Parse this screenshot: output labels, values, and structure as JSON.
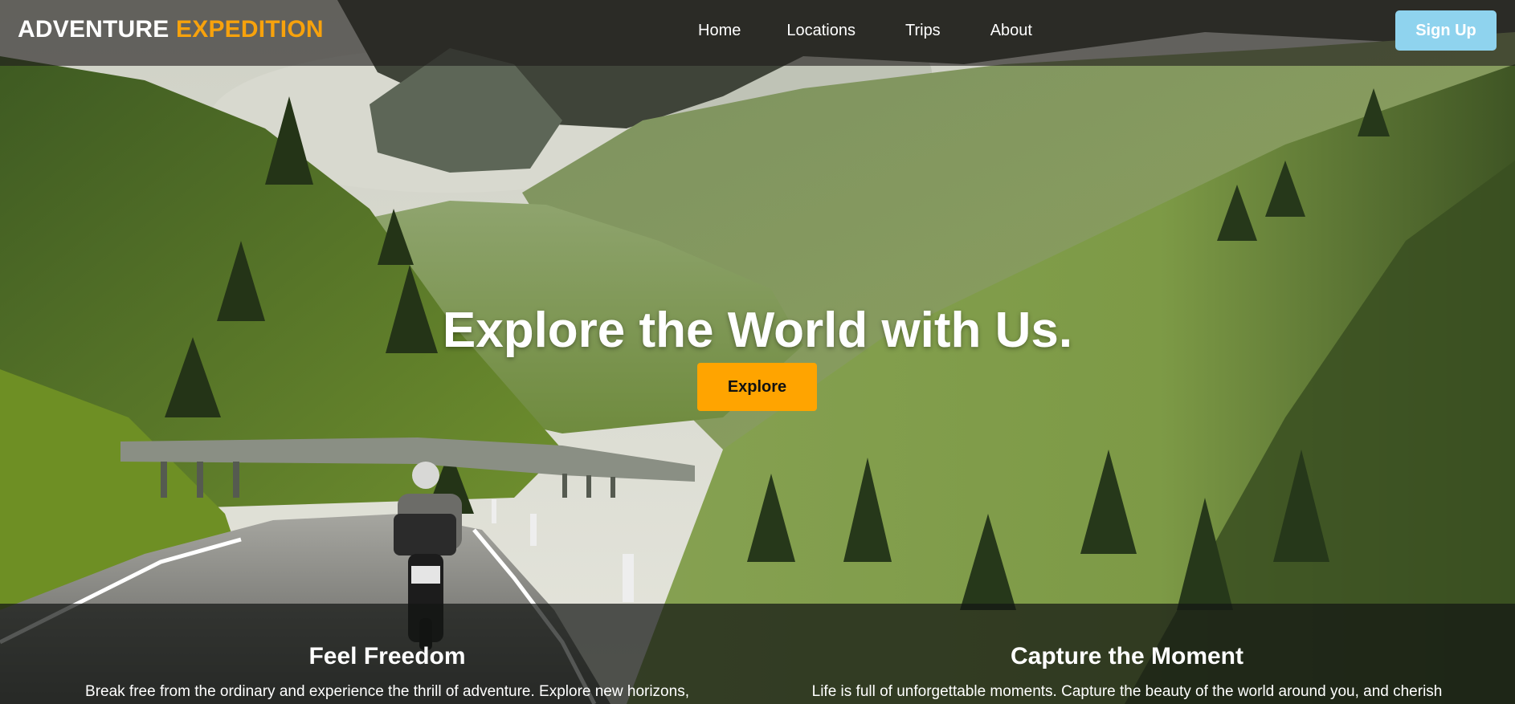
{
  "header": {
    "brand_part1": "ADVENTURE",
    "brand_part2": "EXPEDITION",
    "nav": [
      "Home",
      "Locations",
      "Trips",
      "About"
    ],
    "signup_label": "Sign Up"
  },
  "hero": {
    "title": "Explore the World with Us.",
    "button_label": "Explore"
  },
  "features": [
    {
      "title": "Feel Freedom",
      "text": "Break free from the ordinary and experience the thrill of adventure. Explore new horizons,"
    },
    {
      "title": "Capture the Moment",
      "text": "Life is full of unforgettable moments. Capture the beauty of the world around you, and cherish"
    }
  ],
  "colors": {
    "accent": "#ffa400",
    "brand_highlight": "#f7a20c",
    "signup": "#8fd3ee"
  }
}
